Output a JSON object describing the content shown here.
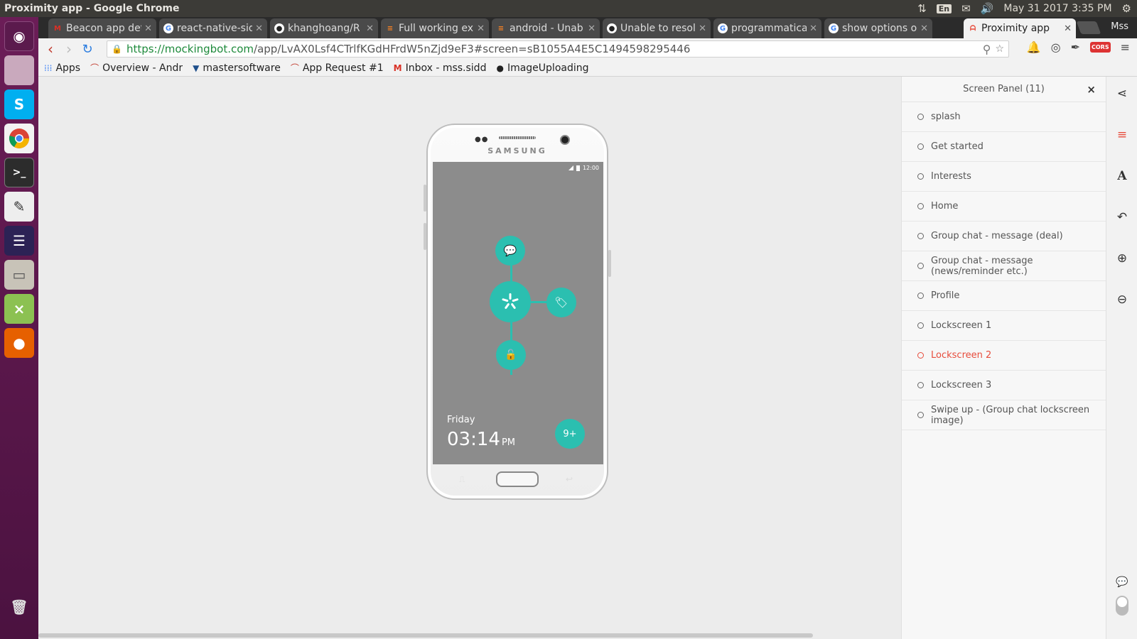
{
  "os": {
    "window_title": "Proximity app - Google Chrome",
    "lang": "En",
    "datetime": "May 31 2017  3:35 PM"
  },
  "browser": {
    "tabs": [
      {
        "label": "Beacon app det",
        "icon": "gmail-icon"
      },
      {
        "label": "react-native-sid",
        "icon": "google-icon"
      },
      {
        "label": "khanghoang/R",
        "icon": "github-icon"
      },
      {
        "label": "Full working ex",
        "icon": "stackoverflow-icon"
      },
      {
        "label": "android - Unab",
        "icon": "stackoverflow-icon"
      },
      {
        "label": "Unable to resol",
        "icon": "github-icon"
      },
      {
        "label": "programmatica",
        "icon": "google-icon"
      },
      {
        "label": "show options o",
        "icon": "google-icon"
      },
      {
        "label": "Proximity app",
        "icon": "mockingbot-icon"
      }
    ],
    "active_tab": 8,
    "profile": "Mss",
    "url_host": "https://mockingbot.com",
    "url_path": "/app/LvAX0Lsf4CTrlfKGdHFrdW5nZjd9eF3#screen=sB1055A4E5C1494598295446",
    "bookmarks": [
      {
        "label": "Apps",
        "icon": "apps-grid-icon"
      },
      {
        "label": "Overview - Andr",
        "icon": "bitbucket-icon"
      },
      {
        "label": "mastersoftware",
        "icon": "bitbucket-icon"
      },
      {
        "label": "App Request #1",
        "icon": "bitbucket-icon"
      },
      {
        "label": "Inbox - mss.sidd",
        "icon": "gmail-icon"
      },
      {
        "label": "ImageUploading",
        "icon": "github-icon"
      }
    ]
  },
  "phone": {
    "brand": "SAMSUNG",
    "status_time": "12:00",
    "day": "Friday",
    "time": "03:14",
    "ampm": "PM",
    "badge": "9+"
  },
  "panel": {
    "title": "Screen Panel (11)",
    "close": "×",
    "items": [
      {
        "label": "splash",
        "active": false
      },
      {
        "label": "Get started",
        "active": false
      },
      {
        "label": "Interests",
        "active": false
      },
      {
        "label": "Home",
        "active": false
      },
      {
        "label": "Group chat - message (deal)",
        "active": false
      },
      {
        "label": "Group chat - message (news/reminder etc.)",
        "active": false
      },
      {
        "label": "Profile",
        "active": false
      },
      {
        "label": "Lockscreen 1",
        "active": false
      },
      {
        "label": "Lockscreen 2",
        "active": true
      },
      {
        "label": "Lockscreen 3",
        "active": false
      },
      {
        "label": "Swipe up - (Group chat lockscreen image)",
        "active": false
      }
    ]
  },
  "colors": {
    "accent_teal": "#2bbfb0",
    "active_red": "#e74c3c",
    "launcher": "#5e1a4f"
  }
}
